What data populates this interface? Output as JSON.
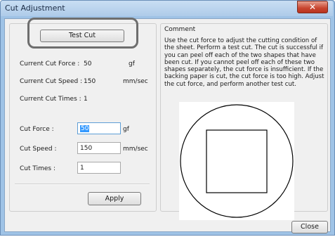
{
  "window": {
    "title": "Cut Adjustment",
    "close_glyph": "✕"
  },
  "left": {
    "test_cut_label": "Test Cut",
    "current": [
      {
        "label": "Current Cut Force :",
        "value": "50",
        "unit": "gf"
      },
      {
        "label": "Current Cut Speed :",
        "value": "150",
        "unit": "mm/sec"
      },
      {
        "label": "Current Cut Times :",
        "value": "1",
        "unit": ""
      }
    ],
    "inputs": [
      {
        "label": "Cut Force :",
        "value": "50",
        "unit": "gf"
      },
      {
        "label": "Cut Speed :",
        "value": "150",
        "unit": "mm/sec"
      },
      {
        "label": "Cut Times :",
        "value": "1",
        "unit": ""
      }
    ],
    "apply_label": "Apply"
  },
  "comment": {
    "heading": "Comment",
    "text": "Use the cut force to adjust the cutting condition of the sheet. Perform a test cut. The cut is successful if you can peel off each of the two shapes that have been cut. If you cannot peel off each of these two shapes separately, the cut force is insufficient. If the backing paper is cut, the cut force is too high. Adjust the cut force, and perform another test cut."
  },
  "footer": {
    "close_label": "Close"
  },
  "colors": {
    "title_bar": "#aecbe9",
    "close_button": "#c8452f",
    "focus_border": "#5e9ed6",
    "selection": "#3399ff"
  }
}
